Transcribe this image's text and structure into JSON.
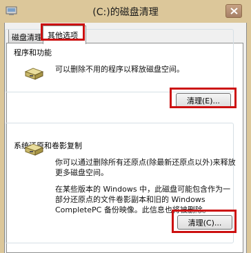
{
  "window": {
    "title": "(C:)的磁盘清理"
  },
  "tabs": [
    {
      "label": "磁盘清理",
      "active": false
    },
    {
      "label": "其他选项",
      "active": true
    }
  ],
  "sections": [
    {
      "label": "程序和功能",
      "description": "可以删除不用的程序以释放磁盘空间。",
      "button": "清理(E)..."
    },
    {
      "label": "系统还原和卷影复制",
      "description": "你可以通过删除所有还原点(除最新还原点以外)来释放更多磁盘空间。",
      "note": "在某些版本的 Windows 中，此磁盘可能包含作为一部分还原点的文件卷影副本和旧的 Windows CompletePC 备份映像。此信息也将被删除。",
      "button": "清理(C)..."
    }
  ],
  "colors": {
    "titlebar": "#dcc79a",
    "highlight": "#cc1010",
    "close_button": "#b88f74"
  },
  "icons": {
    "app": "disk-cleanup-icon",
    "close": "close-icon",
    "section": "drive-icon"
  }
}
